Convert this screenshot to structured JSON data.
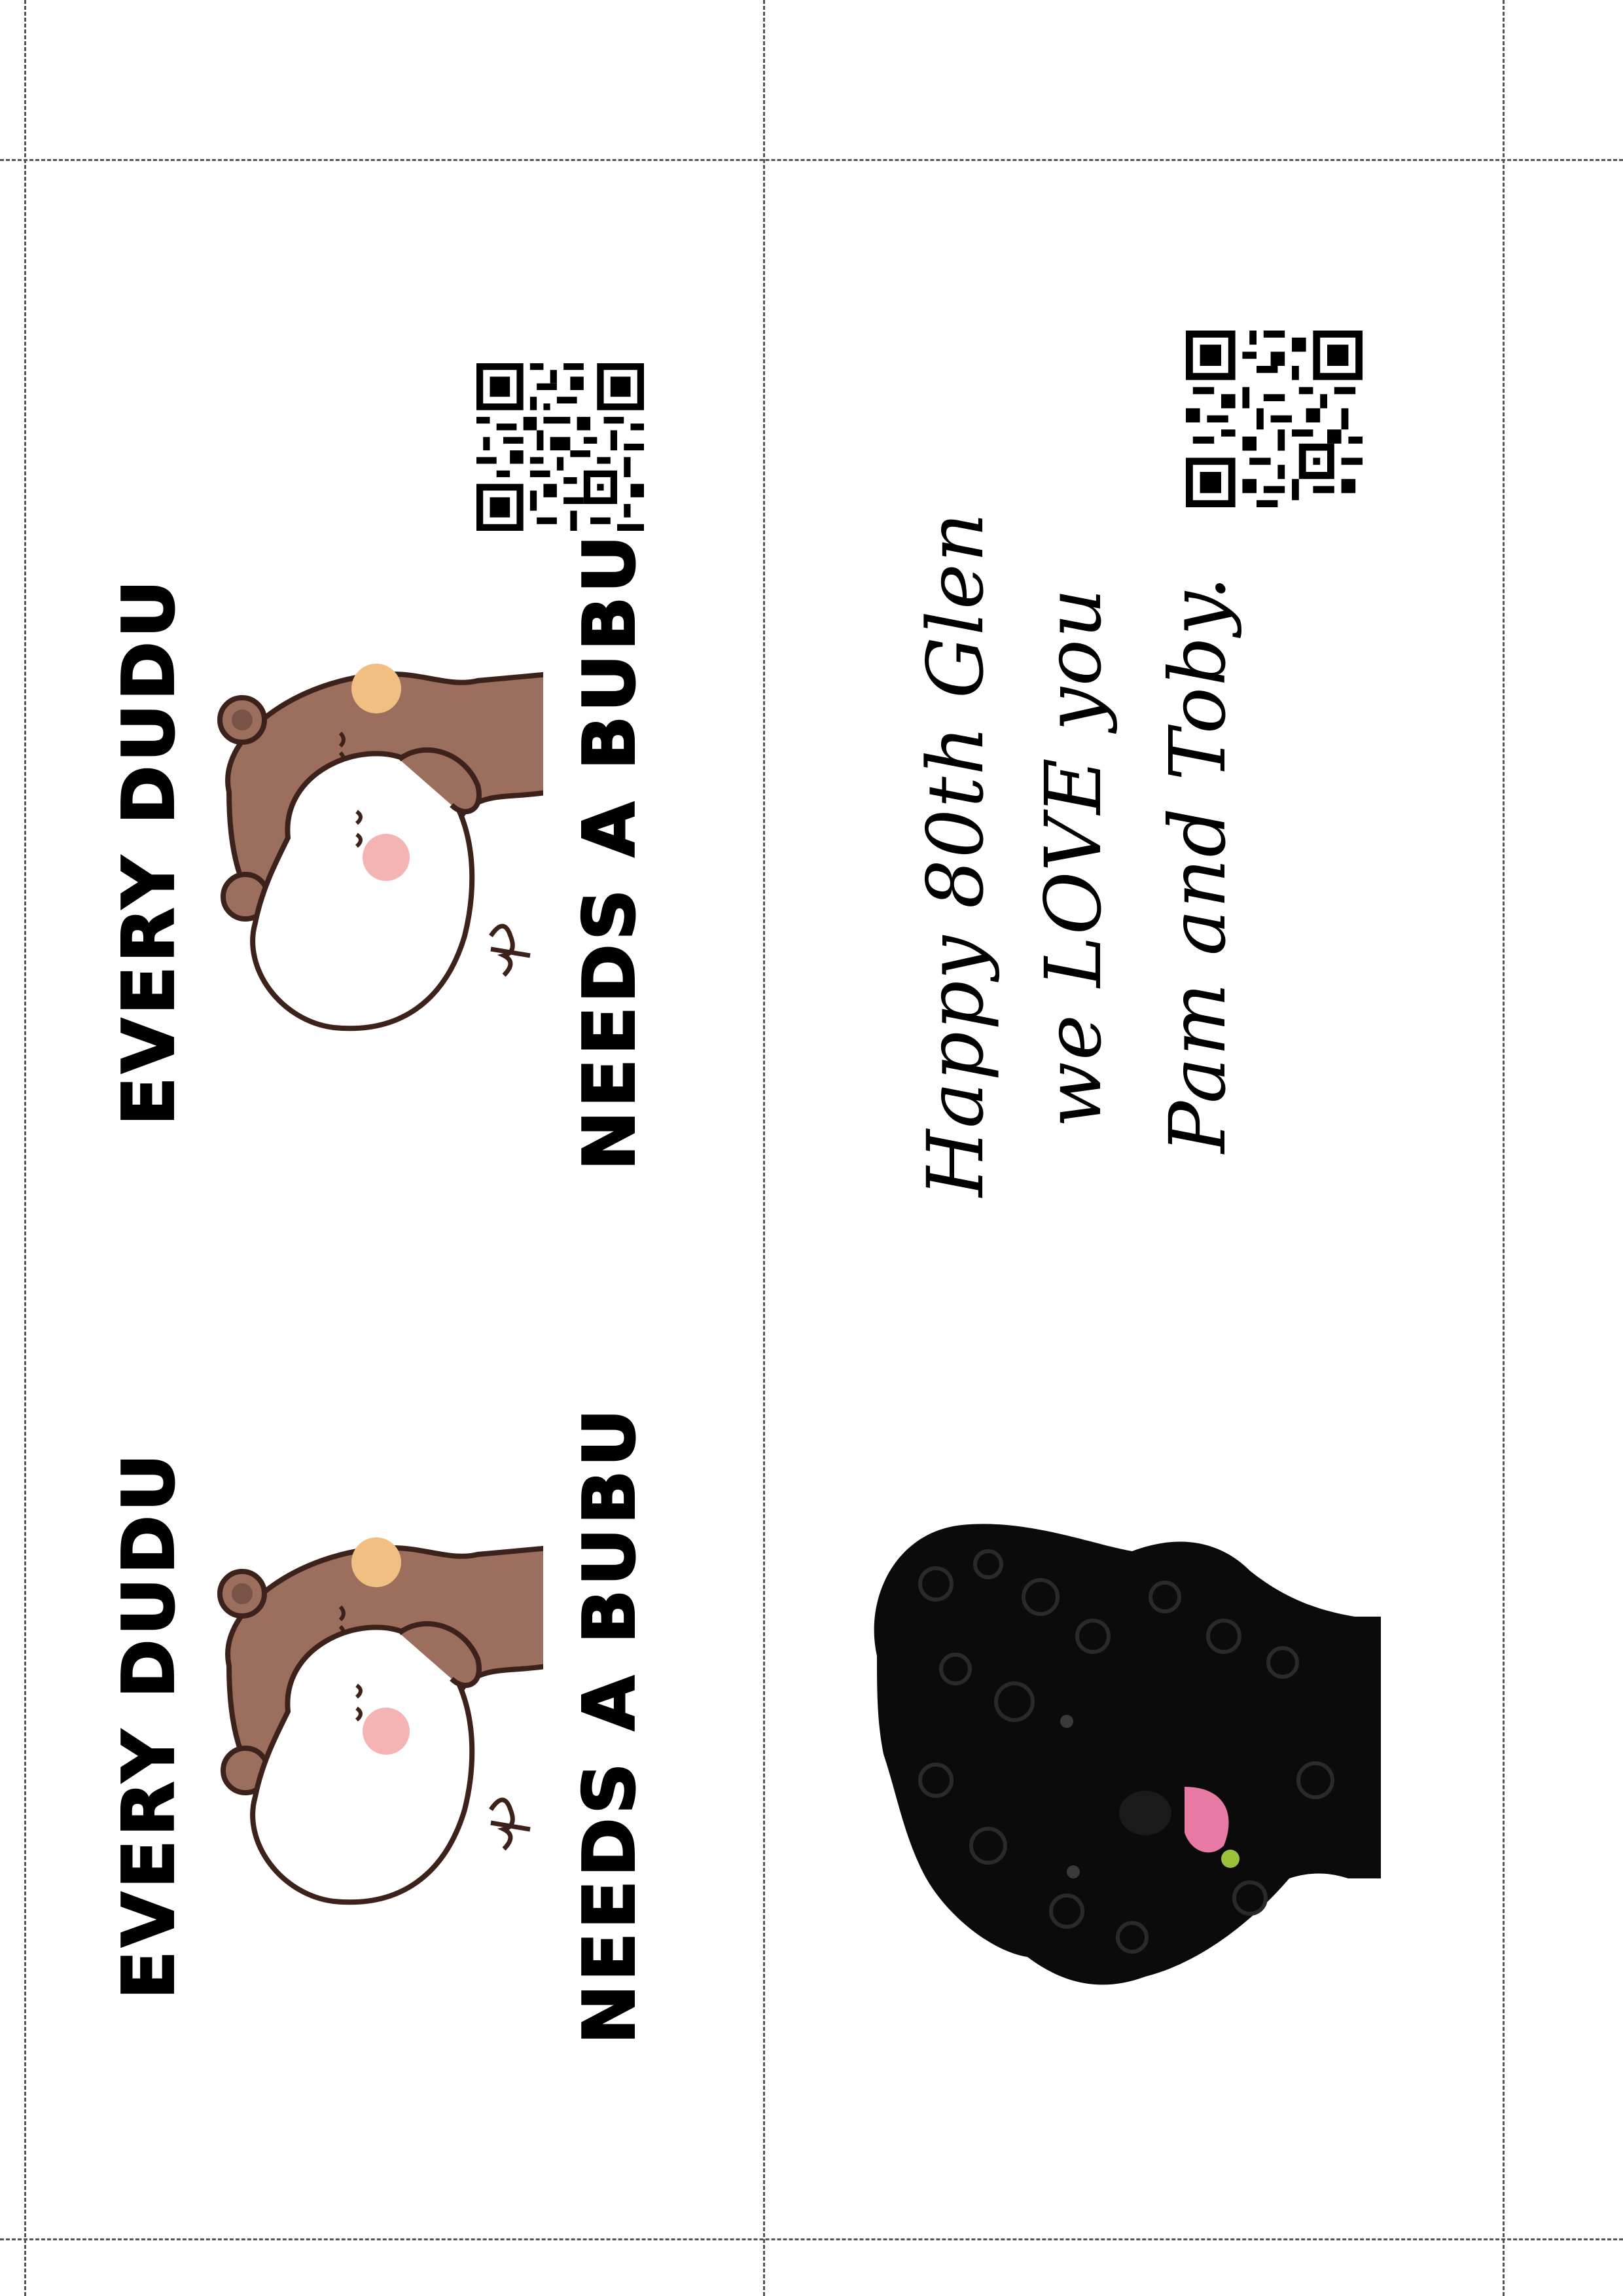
{
  "cards": [
    {
      "line1": "EVERY DUDU",
      "line2": "NEEDS A BUBU",
      "art": "bear-hug-illustration"
    },
    {
      "line1": "EVERY DUDU",
      "line2": "NEEDS A BUBU",
      "art": "bear-hug-illustration"
    }
  ],
  "message": {
    "line1": "Happy 80th Glen",
    "line2": "we LOVE you",
    "line3": "Pam and Toby."
  },
  "images": {
    "qr": "qr-code",
    "photo": "black-poodle-photo"
  },
  "colors": {
    "bear_brown": "#9b6e5e",
    "bear_outline": "#3d221c",
    "ear_spot": "#f2bf83",
    "cheek": "#f5b4b4",
    "guide": "#555555"
  }
}
